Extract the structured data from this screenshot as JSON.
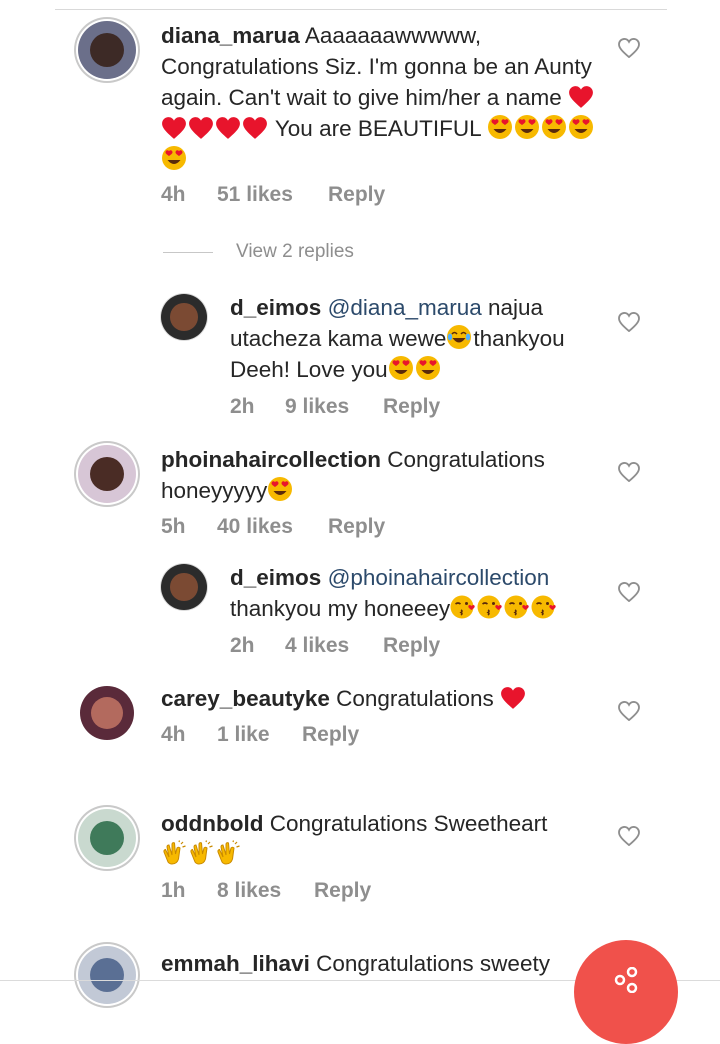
{
  "comments": [
    {
      "username": "diana_marua",
      "text_before": " Aaaaaaawwwww, Congratulations Siz. I'm gonna be an Aunty again. Can't wait to give him/her a name ",
      "text_after": " You are BEAUTIFUL ",
      "time": "4h",
      "likes": "51 likes",
      "reply": "Reply"
    },
    {
      "username": "d_eimos",
      "mention": "@diana_marua",
      "text_before": " najua utacheza kama wewe",
      "text_mid": "thankyou Deeh! Love you",
      "time": "2h",
      "likes": "9 likes",
      "reply": "Reply"
    },
    {
      "username": "phoinahaircollection",
      "text_before": " Congratulations honeyyyyy",
      "time": "5h",
      "likes": "40 likes",
      "reply": "Reply"
    },
    {
      "username": "d_eimos",
      "mention": "@phoinahaircollection",
      "text_before": "thankyou my honeeey",
      "time": "2h",
      "likes": "4 likes",
      "reply": "Reply"
    },
    {
      "username": "carey_beautyke",
      "text_before": " Congratulations ",
      "time": "4h",
      "likes": "1 like",
      "reply": "Reply"
    },
    {
      "username": "oddnbold",
      "text_before": " Congratulations Sweetheart",
      "time": "1h",
      "likes": "8 likes",
      "reply": "Reply"
    },
    {
      "username": "emmah_lihavi",
      "text_before": " Congratulations sweety"
    }
  ],
  "view_replies": "View 2 replies",
  "colors": {
    "heart_red": "#e8142c",
    "emoji_yellow": "#f7b900",
    "meta_gray": "#8e8e8e",
    "fab_red": "#f0514b",
    "mention_blue": "#2c4a6b"
  }
}
